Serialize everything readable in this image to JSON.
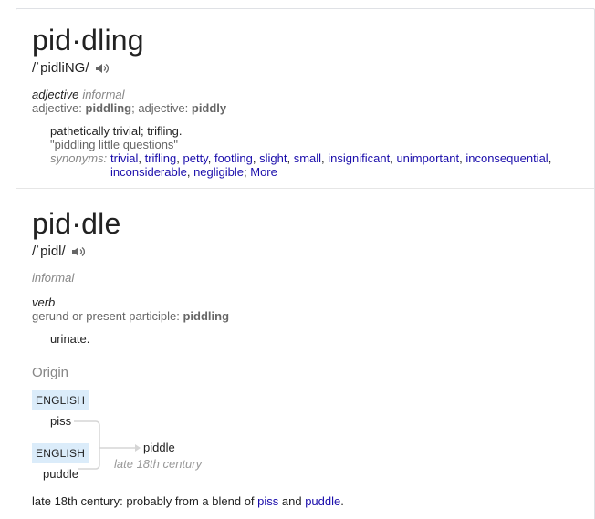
{
  "entry1": {
    "word": "pid·dling",
    "phonetic": "/ˈpidliNG/",
    "pos": "adjective",
    "register": "informal",
    "forms": {
      "label1": "adjective: ",
      "form1": "piddling",
      "sep": "; ",
      "label2": "adjective: ",
      "form2": "piddly"
    },
    "definition": "pathetically trivial; trifling.",
    "example": "\"piddling little questions\"",
    "synonyms_label": "synonyms:",
    "synonyms": [
      "trivial",
      "trifling",
      "petty",
      "footling",
      "slight",
      "small",
      "insignificant",
      "unimportant",
      "inconsequential",
      "inconsiderable",
      "negligible"
    ],
    "more": "More"
  },
  "entry2": {
    "word": "pid·dle",
    "phonetic": "/ˈpidl/",
    "register": "informal",
    "pos": "verb",
    "forms": {
      "label": "gerund or present participle: ",
      "form": "piddling"
    },
    "definition": "urinate."
  },
  "origin": {
    "heading": "Origin",
    "lang1": "ENGLISH",
    "word1": "piss",
    "lang2": "ENGLISH",
    "word2": "puddle",
    "result": "piddle",
    "date": "late 18th century",
    "text_before": "late 18th century: probably from a blend of ",
    "link1": "piss",
    "text_mid": " and ",
    "link2": "puddle",
    "text_after": "."
  },
  "icons": {
    "speaker": "speaker-icon"
  },
  "colors": {
    "link": "#1a0dab",
    "lang_badge": "#dbecfa",
    "muted": "#878787"
  }
}
